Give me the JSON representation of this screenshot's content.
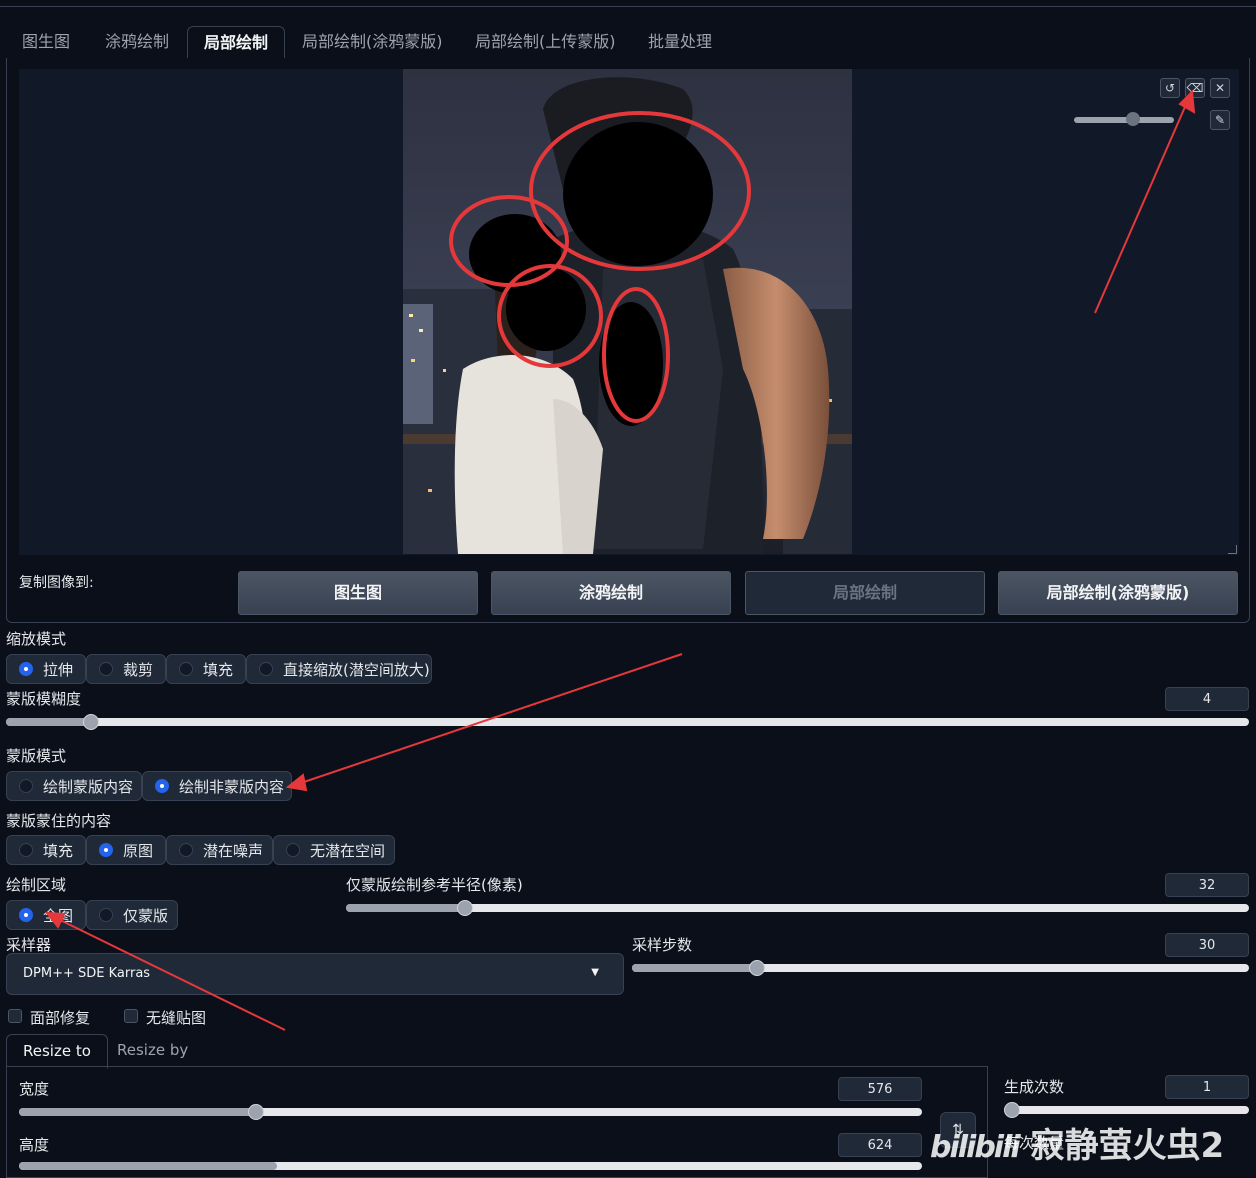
{
  "tabs": [
    {
      "label": "图生图"
    },
    {
      "label": "涂鸦绘制"
    },
    {
      "label": "局部绘制"
    },
    {
      "label": "局部绘制(涂鸦蒙版)"
    },
    {
      "label": "局部绘制(上传蒙版)"
    },
    {
      "label": "批量处理"
    }
  ],
  "active_tab": "局部绘制",
  "canvas_tools": {
    "undo_icon": "undo-icon",
    "eraser_icon": "eraser-icon",
    "close_icon": "close-icon",
    "brush_icon": "brush-icon",
    "brush_size_level": 0.6
  },
  "copy_to": {
    "label": "复制图像到:",
    "buttons": [
      "图生图",
      "涂鸦绘制",
      "局部绘制",
      "局部绘制(涂鸦蒙版)"
    ]
  },
  "resize_mode": {
    "label": "缩放模式",
    "options": [
      "拉伸",
      "裁剪",
      "填充",
      "直接缩放(潜空间放大)"
    ],
    "selected": "拉伸"
  },
  "mask_blur": {
    "label": "蒙版模糊度",
    "value": "4"
  },
  "mask_mode": {
    "label": "蒙版模式",
    "options": [
      "绘制蒙版内容",
      "绘制非蒙版内容"
    ],
    "selected": "绘制非蒙版内容"
  },
  "masked_content": {
    "label": "蒙版蒙住的内容",
    "options": [
      "填充",
      "原图",
      "潜在噪声",
      "无潜在空间"
    ],
    "selected": "原图"
  },
  "inpaint_area": {
    "label": "绘制区域",
    "options": [
      "全图",
      "仅蒙版"
    ],
    "selected": "全图"
  },
  "only_masked_padding": {
    "label": "仅蒙版绘制参考半径(像素)",
    "value": "32"
  },
  "sampler": {
    "label": "采样器",
    "value": "DPM++ SDE Karras"
  },
  "steps": {
    "label": "采样步数",
    "value": "30"
  },
  "checkboxes": [
    {
      "label": "面部修复",
      "checked": false
    },
    {
      "label": "无缝贴图",
      "checked": false
    }
  ],
  "size_tabs": [
    "Resize to",
    "Resize by"
  ],
  "width": {
    "label": "宽度",
    "value": "576"
  },
  "height": {
    "label": "高度",
    "value": "624"
  },
  "batch_count": {
    "label": "生成次数",
    "value": "1"
  },
  "batch_size": {
    "label": "每次数量"
  },
  "swap_icon": "swap-icon",
  "watermark": {
    "logo": "bilibili",
    "text": "寂静萤火虫2"
  },
  "colors": {
    "background": "#0b0f19",
    "accent": "#2563eb",
    "annotation_red": "#e5383b"
  }
}
